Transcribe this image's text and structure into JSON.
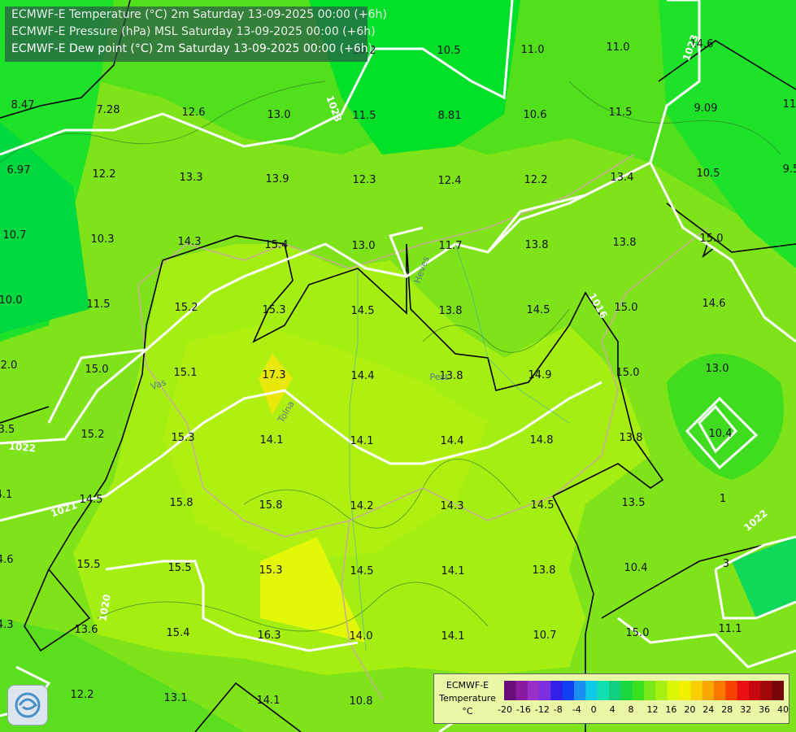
{
  "header": {
    "line1": "ECMWF-E Temperature (°C) 2m Saturday 13-09-2025 00:00 (+6h)",
    "line2": "ECMWF-E Pressure (hPa) MSL Saturday 13-09-2025 00:00 (+6h)",
    "line3": "ECMWF-E Dew point (°C) 2m Saturday 13-09-2025 00:00 (+6h)"
  },
  "temps": [
    "8.47",
    "7.28",
    "12.6",
    "13.0",
    "11.5",
    "8.81",
    "10.6",
    "11.5",
    "9.09",
    "11.",
    "6.97",
    "12.2",
    "13.3",
    "13.9",
    "12.3",
    "12.4",
    "12.2",
    "13.4",
    "10.5",
    "9.5",
    "10.7",
    "10.3",
    "14.3",
    "15.4",
    "13.0",
    "11.7",
    "13.8",
    "13.8",
    "15.0",
    "10.0",
    "11.5",
    "15.2",
    "15.3",
    "14.5",
    "13.8",
    "14.5",
    "15.0",
    "14.6",
    "2.0",
    "15.0",
    "15.1",
    "17.3",
    "14.4",
    "13.8",
    "14.9",
    "15.0",
    "13.0",
    "3.5",
    "15.2",
    "15.3",
    "14.1",
    "14.1",
    "14.4",
    "14.8",
    "13.8",
    "10.4",
    "4.1",
    "14.5",
    "15.8",
    "15.8",
    "14.2",
    "14.3",
    "14.5",
    "13.5",
    "1",
    "14.6",
    "15.5",
    "15.5",
    "15.3",
    "14.5",
    "14.1",
    "13.8",
    "10.4",
    "3",
    "14.3",
    "13.6",
    "15.4",
    "16.3",
    "14.0",
    "14.1",
    "10.7",
    "15.0",
    "11.1",
    "12.2",
    "13.1",
    "14.1",
    "10.8",
    "10.2",
    "10.5",
    "11.0",
    "11.0",
    "14.6"
  ],
  "isobars": [
    "1023",
    "1023",
    "1022",
    "1021",
    "1020",
    "1022",
    "1016"
  ],
  "places": [
    "Vas",
    "Tolna",
    "Pest",
    "Heves"
  ],
  "legend": {
    "title_lines": [
      "ECMWF-E",
      "Temperature",
      "°C"
    ],
    "ticks": [
      "-20",
      "-16",
      "-12",
      "-8",
      "-4",
      "0",
      "4",
      "8",
      "12",
      "16",
      "20",
      "24",
      "28",
      "32",
      "36",
      "40"
    ],
    "colors": [
      "#6a0d7a",
      "#8a1aa0",
      "#9a30c8",
      "#7a30e0",
      "#3020e8",
      "#1040f0",
      "#1a90f0",
      "#10c8e8",
      "#10e0b0",
      "#10d080",
      "#18d840",
      "#38e020",
      "#78e818",
      "#a8f010",
      "#d8f808",
      "#f0f000",
      "#f8d000",
      "#f8a800",
      "#f87800",
      "#f84000",
      "#e81010",
      "#c80810",
      "#a00808",
      "#780808"
    ]
  },
  "colors": {
    "land_high": "#b8f010",
    "land_mid": "#98ec12",
    "land_low": "#48dc1c",
    "land_cold": "#00e030",
    "isobar": "#ffffff",
    "contour": "#000000",
    "border": "#c8b090"
  }
}
